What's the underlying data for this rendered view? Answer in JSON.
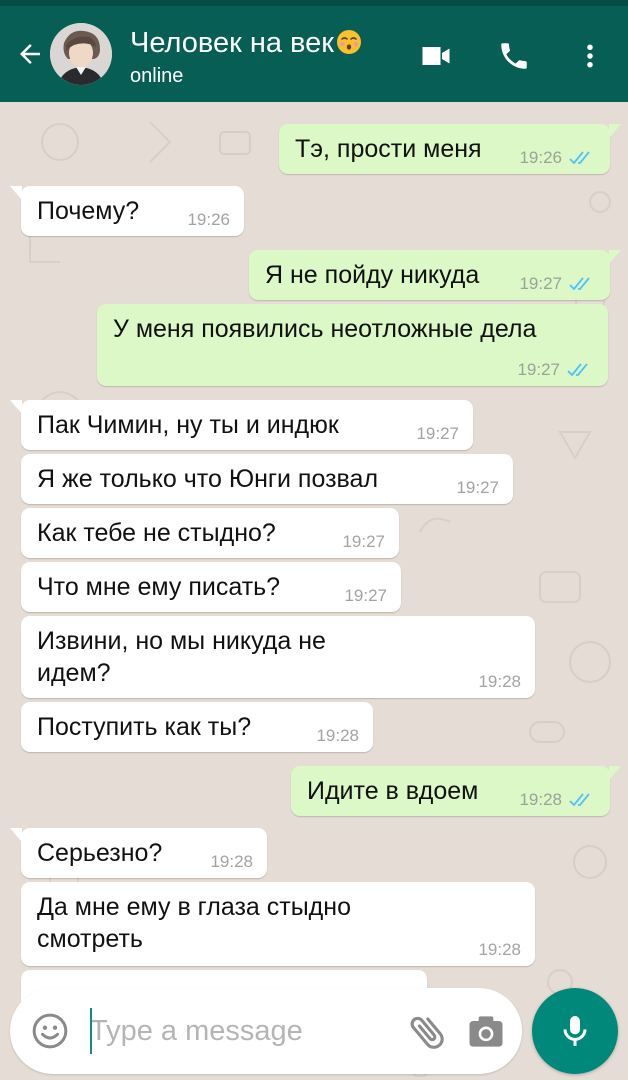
{
  "header": {
    "contact_name": "Человек на век",
    "contact_status": "online",
    "emoji_icon": "kissing-face-emoji",
    "back_icon": "arrow-left-icon",
    "video_icon": "video-camera-icon",
    "call_icon": "phone-icon",
    "more_icon": "more-vertical-icon"
  },
  "colors": {
    "header_bg": "#075e54",
    "chat_bg": "#e5ddd5",
    "outgoing_bubble": "#dcf8c6",
    "incoming_bubble": "#ffffff",
    "read_ticks": "#4fc3f7",
    "mic_button": "#00897b"
  },
  "messages": [
    {
      "direction": "out",
      "text": "Тэ, прости меня",
      "time": "19:26",
      "status": "read"
    },
    {
      "direction": "in",
      "text": "Почему?",
      "time": "19:26"
    },
    {
      "direction": "out",
      "text": "Я не пойду никуда",
      "time": "19:27",
      "status": "read"
    },
    {
      "direction": "out",
      "text": "У меня появились неотложные дела",
      "time": "19:27",
      "status": "read"
    },
    {
      "direction": "in",
      "text": "Пак Чимин, ну ты и индюк",
      "time": "19:27"
    },
    {
      "direction": "in",
      "text": "Я же только что Юнги позвал",
      "time": "19:27"
    },
    {
      "direction": "in",
      "text": "Как тебе не стыдно?",
      "time": "19:27"
    },
    {
      "direction": "in",
      "text": "Что мне ему писать?",
      "time": "19:27"
    },
    {
      "direction": "in",
      "text": "Извини, но мы никуда не идем?",
      "time": "19:28"
    },
    {
      "direction": "in",
      "text": "Поступить как ты?",
      "time": "19:28"
    },
    {
      "direction": "out",
      "text": "Идите в вдоем",
      "time": "19:28",
      "status": "read"
    },
    {
      "direction": "in",
      "text": "Серьезно?",
      "time": "19:28"
    },
    {
      "direction": "in",
      "text": "Да мне ему в глаза стыдно смотреть",
      "time": "19:28"
    }
  ],
  "input": {
    "placeholder": "Type a message",
    "value": "",
    "emoji_icon": "smiley-icon",
    "attach_icon": "paperclip-icon",
    "camera_icon": "camera-icon",
    "mic_icon": "microphone-icon"
  }
}
